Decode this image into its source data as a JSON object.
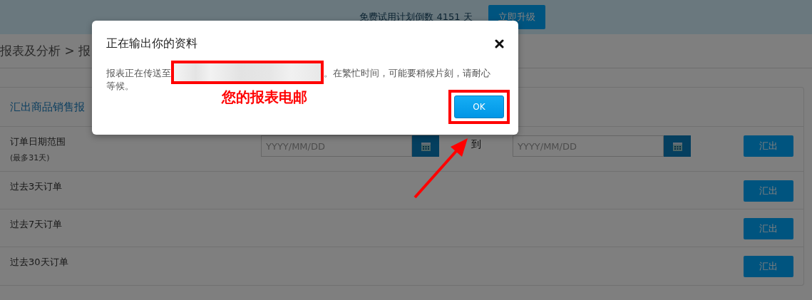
{
  "banner": {
    "text": "免费试用计划倒数 4151 天",
    "button": "立即升级"
  },
  "breadcrumb": "报表及分析 > 报",
  "card": {
    "title": "汇出商品销售报",
    "rows": [
      {
        "kind": "range",
        "label": "订单日期范围",
        "note": "(最多31天)",
        "from_placeholder": "YYYY/MM/DD",
        "to_label": "到",
        "to_placeholder": "YYYY/MM/DD",
        "button": "汇出"
      },
      {
        "kind": "simple",
        "label": "过去3天订单",
        "button": "汇出"
      },
      {
        "kind": "simple",
        "label": "过去7天订单",
        "button": "汇出"
      },
      {
        "kind": "simple",
        "label": "过去30天订单",
        "button": "汇出"
      }
    ]
  },
  "dialog": {
    "title": "正在输出你的资料",
    "message_before": "报表正在传送至",
    "message_after": "。在繁忙时间，可能要稍候片刻，请耐心等候。",
    "button": "OK"
  },
  "annotation": {
    "text": "您的报表电邮"
  }
}
